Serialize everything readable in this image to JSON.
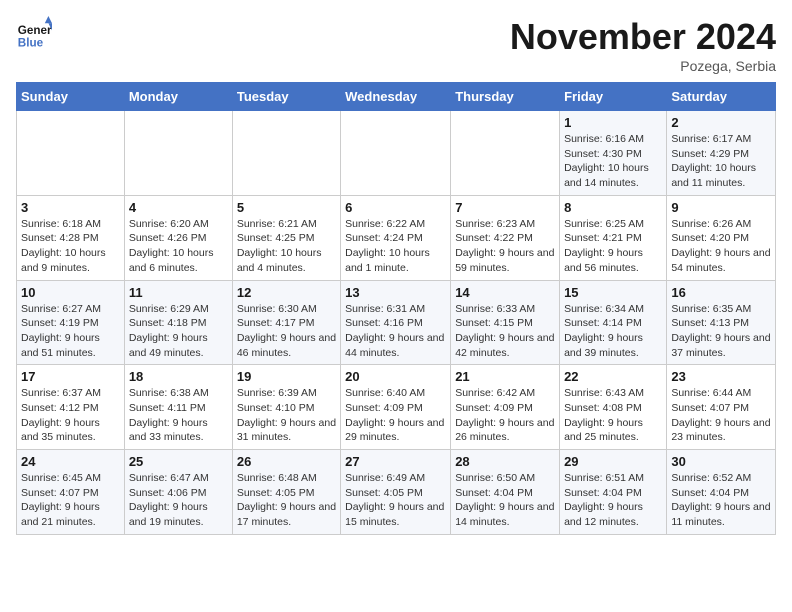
{
  "header": {
    "logo_line1": "General",
    "logo_line2": "Blue",
    "month": "November 2024",
    "location": "Pozega, Serbia"
  },
  "days_of_week": [
    "Sunday",
    "Monday",
    "Tuesday",
    "Wednesday",
    "Thursday",
    "Friday",
    "Saturday"
  ],
  "weeks": [
    [
      {
        "day": "",
        "sunrise": "",
        "sunset": "",
        "daylight": ""
      },
      {
        "day": "",
        "sunrise": "",
        "sunset": "",
        "daylight": ""
      },
      {
        "day": "",
        "sunrise": "",
        "sunset": "",
        "daylight": ""
      },
      {
        "day": "",
        "sunrise": "",
        "sunset": "",
        "daylight": ""
      },
      {
        "day": "",
        "sunrise": "",
        "sunset": "",
        "daylight": ""
      },
      {
        "day": "1",
        "sunrise": "Sunrise: 6:16 AM",
        "sunset": "Sunset: 4:30 PM",
        "daylight": "Daylight: 10 hours and 14 minutes."
      },
      {
        "day": "2",
        "sunrise": "Sunrise: 6:17 AM",
        "sunset": "Sunset: 4:29 PM",
        "daylight": "Daylight: 10 hours and 11 minutes."
      }
    ],
    [
      {
        "day": "3",
        "sunrise": "Sunrise: 6:18 AM",
        "sunset": "Sunset: 4:28 PM",
        "daylight": "Daylight: 10 hours and 9 minutes."
      },
      {
        "day": "4",
        "sunrise": "Sunrise: 6:20 AM",
        "sunset": "Sunset: 4:26 PM",
        "daylight": "Daylight: 10 hours and 6 minutes."
      },
      {
        "day": "5",
        "sunrise": "Sunrise: 6:21 AM",
        "sunset": "Sunset: 4:25 PM",
        "daylight": "Daylight: 10 hours and 4 minutes."
      },
      {
        "day": "6",
        "sunrise": "Sunrise: 6:22 AM",
        "sunset": "Sunset: 4:24 PM",
        "daylight": "Daylight: 10 hours and 1 minute."
      },
      {
        "day": "7",
        "sunrise": "Sunrise: 6:23 AM",
        "sunset": "Sunset: 4:22 PM",
        "daylight": "Daylight: 9 hours and 59 minutes."
      },
      {
        "day": "8",
        "sunrise": "Sunrise: 6:25 AM",
        "sunset": "Sunset: 4:21 PM",
        "daylight": "Daylight: 9 hours and 56 minutes."
      },
      {
        "day": "9",
        "sunrise": "Sunrise: 6:26 AM",
        "sunset": "Sunset: 4:20 PM",
        "daylight": "Daylight: 9 hours and 54 minutes."
      }
    ],
    [
      {
        "day": "10",
        "sunrise": "Sunrise: 6:27 AM",
        "sunset": "Sunset: 4:19 PM",
        "daylight": "Daylight: 9 hours and 51 minutes."
      },
      {
        "day": "11",
        "sunrise": "Sunrise: 6:29 AM",
        "sunset": "Sunset: 4:18 PM",
        "daylight": "Daylight: 9 hours and 49 minutes."
      },
      {
        "day": "12",
        "sunrise": "Sunrise: 6:30 AM",
        "sunset": "Sunset: 4:17 PM",
        "daylight": "Daylight: 9 hours and 46 minutes."
      },
      {
        "day": "13",
        "sunrise": "Sunrise: 6:31 AM",
        "sunset": "Sunset: 4:16 PM",
        "daylight": "Daylight: 9 hours and 44 minutes."
      },
      {
        "day": "14",
        "sunrise": "Sunrise: 6:33 AM",
        "sunset": "Sunset: 4:15 PM",
        "daylight": "Daylight: 9 hours and 42 minutes."
      },
      {
        "day": "15",
        "sunrise": "Sunrise: 6:34 AM",
        "sunset": "Sunset: 4:14 PM",
        "daylight": "Daylight: 9 hours and 39 minutes."
      },
      {
        "day": "16",
        "sunrise": "Sunrise: 6:35 AM",
        "sunset": "Sunset: 4:13 PM",
        "daylight": "Daylight: 9 hours and 37 minutes."
      }
    ],
    [
      {
        "day": "17",
        "sunrise": "Sunrise: 6:37 AM",
        "sunset": "Sunset: 4:12 PM",
        "daylight": "Daylight: 9 hours and 35 minutes."
      },
      {
        "day": "18",
        "sunrise": "Sunrise: 6:38 AM",
        "sunset": "Sunset: 4:11 PM",
        "daylight": "Daylight: 9 hours and 33 minutes."
      },
      {
        "day": "19",
        "sunrise": "Sunrise: 6:39 AM",
        "sunset": "Sunset: 4:10 PM",
        "daylight": "Daylight: 9 hours and 31 minutes."
      },
      {
        "day": "20",
        "sunrise": "Sunrise: 6:40 AM",
        "sunset": "Sunset: 4:09 PM",
        "daylight": "Daylight: 9 hours and 29 minutes."
      },
      {
        "day": "21",
        "sunrise": "Sunrise: 6:42 AM",
        "sunset": "Sunset: 4:09 PM",
        "daylight": "Daylight: 9 hours and 26 minutes."
      },
      {
        "day": "22",
        "sunrise": "Sunrise: 6:43 AM",
        "sunset": "Sunset: 4:08 PM",
        "daylight": "Daylight: 9 hours and 25 minutes."
      },
      {
        "day": "23",
        "sunrise": "Sunrise: 6:44 AM",
        "sunset": "Sunset: 4:07 PM",
        "daylight": "Daylight: 9 hours and 23 minutes."
      }
    ],
    [
      {
        "day": "24",
        "sunrise": "Sunrise: 6:45 AM",
        "sunset": "Sunset: 4:07 PM",
        "daylight": "Daylight: 9 hours and 21 minutes."
      },
      {
        "day": "25",
        "sunrise": "Sunrise: 6:47 AM",
        "sunset": "Sunset: 4:06 PM",
        "daylight": "Daylight: 9 hours and 19 minutes."
      },
      {
        "day": "26",
        "sunrise": "Sunrise: 6:48 AM",
        "sunset": "Sunset: 4:05 PM",
        "daylight": "Daylight: 9 hours and 17 minutes."
      },
      {
        "day": "27",
        "sunrise": "Sunrise: 6:49 AM",
        "sunset": "Sunset: 4:05 PM",
        "daylight": "Daylight: 9 hours and 15 minutes."
      },
      {
        "day": "28",
        "sunrise": "Sunrise: 6:50 AM",
        "sunset": "Sunset: 4:04 PM",
        "daylight": "Daylight: 9 hours and 14 minutes."
      },
      {
        "day": "29",
        "sunrise": "Sunrise: 6:51 AM",
        "sunset": "Sunset: 4:04 PM",
        "daylight": "Daylight: 9 hours and 12 minutes."
      },
      {
        "day": "30",
        "sunrise": "Sunrise: 6:52 AM",
        "sunset": "Sunset: 4:04 PM",
        "daylight": "Daylight: 9 hours and 11 minutes."
      }
    ]
  ]
}
